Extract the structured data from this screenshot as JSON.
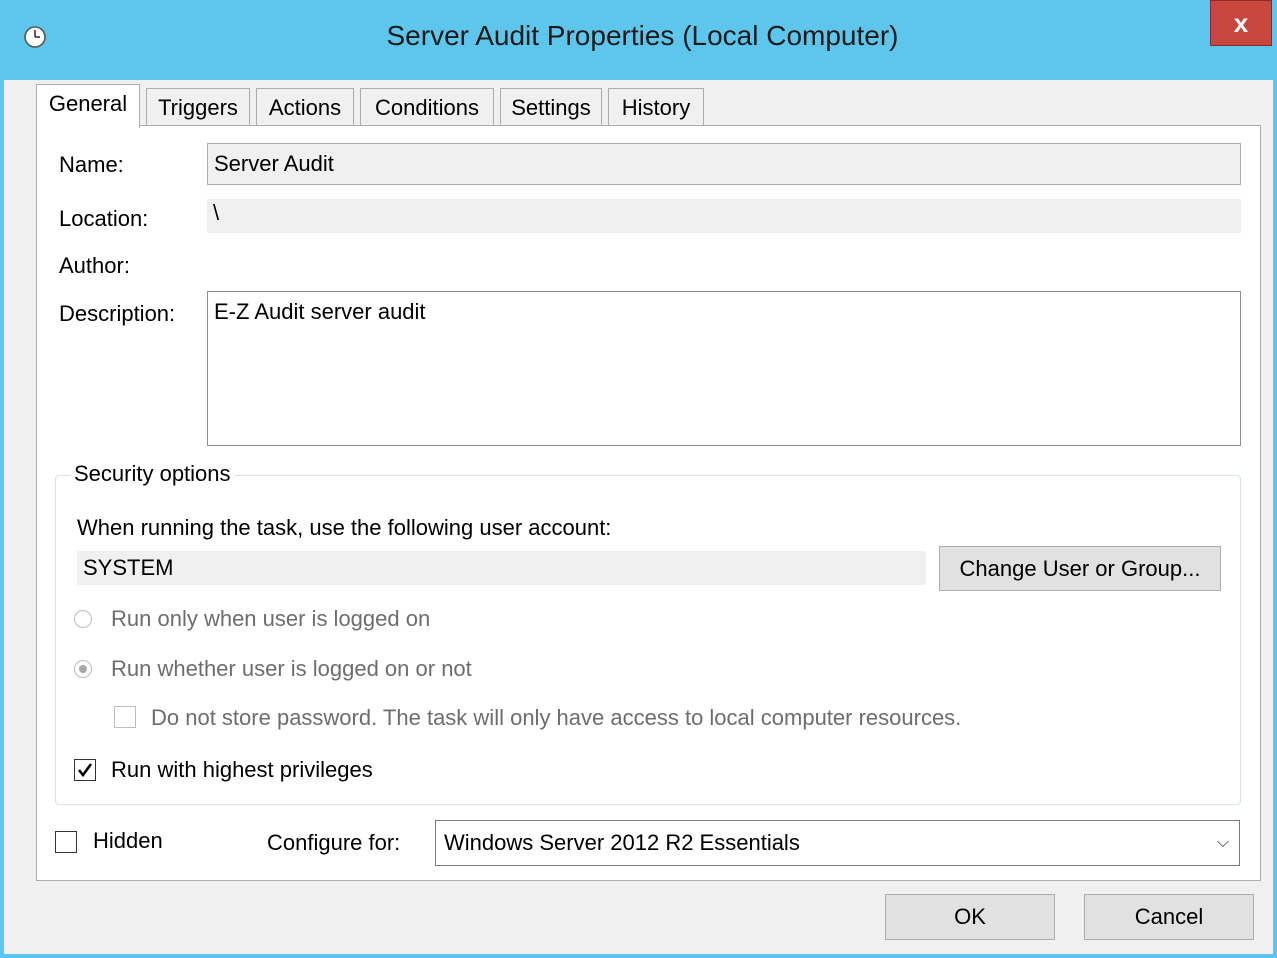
{
  "window": {
    "title": "Server Audit Properties (Local Computer)",
    "close_label": "x",
    "icon": "clock-icon"
  },
  "tabs": [
    {
      "label": "General",
      "active": true
    },
    {
      "label": "Triggers",
      "active": false
    },
    {
      "label": "Actions",
      "active": false
    },
    {
      "label": "Conditions",
      "active": false
    },
    {
      "label": "Settings",
      "active": false
    },
    {
      "label": "History",
      "active": false
    }
  ],
  "general": {
    "name_label": "Name:",
    "name_value": "Server Audit",
    "location_label": "Location:",
    "location_value": "\\",
    "author_label": "Author:",
    "description_label": "Description:",
    "description_value": "E-Z Audit server audit"
  },
  "security": {
    "legend": "Security options",
    "account_prompt": "When running the task, use the following user account:",
    "account_value": "SYSTEM",
    "change_button": "Change User or Group...",
    "radio_logged_on": "Run only when user is logged on",
    "radio_logged_on_selected": false,
    "radio_whether": "Run whether user is logged on or not",
    "radio_whether_selected": true,
    "no_store_password": "Do not store password.  The task will only have access to local computer resources.",
    "no_store_password_checked": false,
    "highest_privileges": "Run with highest privileges",
    "highest_privileges_checked": true
  },
  "bottom": {
    "hidden_label": "Hidden",
    "hidden_checked": false,
    "configure_label": "Configure for:",
    "configure_value": "Windows Server 2012 R2 Essentials"
  },
  "buttons": {
    "ok": "OK",
    "cancel": "Cancel"
  },
  "colors": {
    "titlebar": "#5ec6ec",
    "close": "#c7463d"
  }
}
